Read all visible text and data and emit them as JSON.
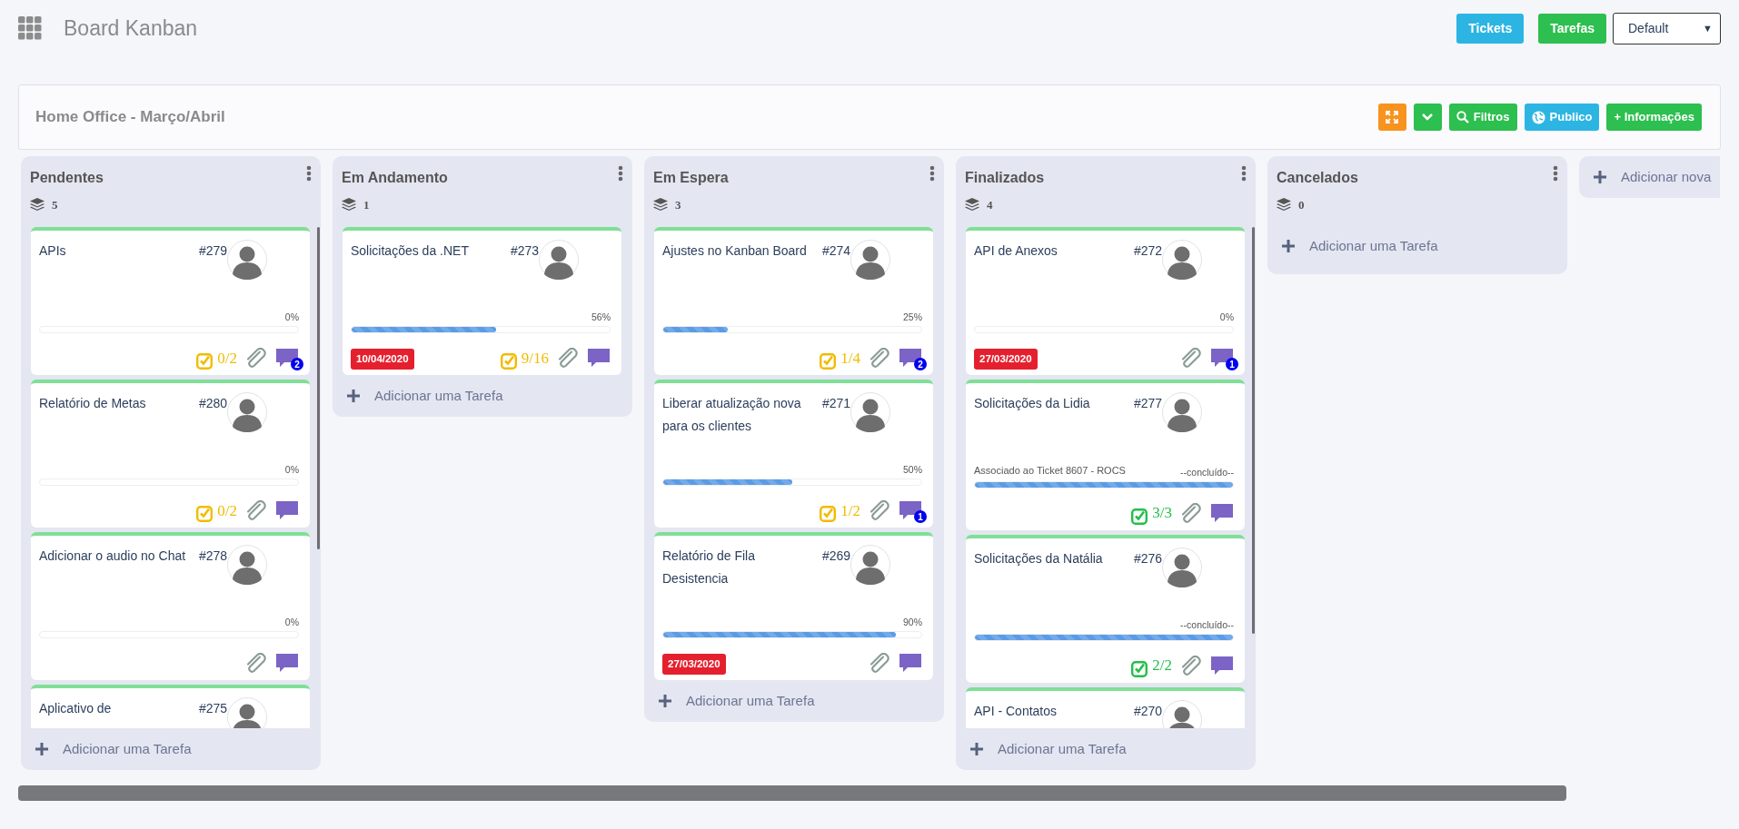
{
  "header": {
    "title": "Board Kanban",
    "buttons": [
      {
        "label": "Tickets",
        "color": "#2cb5e3"
      },
      {
        "label": "Tarefas",
        "color": "#2dbf4f"
      }
    ],
    "select": {
      "value": "Default",
      "arrow": "▼"
    }
  },
  "board": {
    "title": "Home Office - Março/Abril",
    "actions": [
      {
        "kind": "expand",
        "color": "#f7931e"
      },
      {
        "kind": "collapse",
        "color": "#2dbf4f"
      },
      {
        "kind": "search",
        "label": "Filtros",
        "color": "#2dbf4f"
      },
      {
        "kind": "globe",
        "label": "Publico",
        "color": "#2cb5e3"
      },
      {
        "kind": "text",
        "label": "+ Informações",
        "color": "#2dbf4f"
      }
    ]
  },
  "columns": [
    {
      "title": "Pendentes",
      "count": "5",
      "add_label": "Adicionar uma Tarefa",
      "cards": [
        {
          "title": "APIs",
          "number": "#279",
          "progress_label": "0%",
          "level": 0,
          "checklist": {
            "text": "0/2",
            "done": false
          },
          "comments": "2"
        },
        {
          "title": "Relatório de Metas",
          "number": "#280",
          "progress_label": "0%",
          "level": 0,
          "checklist": {
            "text": "0/2",
            "done": false
          }
        },
        {
          "title": "Adicionar o audio no Chat",
          "number": "#278",
          "progress_label": "0%",
          "level": 0
        },
        {
          "title": "Aplicativo de",
          "number": "#275",
          "partial": true
        }
      ]
    },
    {
      "title": "Em Andamento",
      "count": "1",
      "add_label": "Adicionar uma Tarefa",
      "cards": [
        {
          "title": "Solicitações da .NET",
          "number": "#273",
          "progress_label": "56%",
          "level": 0.56,
          "date": "10/04/2020",
          "checklist": {
            "text": "9/16",
            "done": false
          }
        }
      ]
    },
    {
      "title": "Em Espera",
      "count": "3",
      "add_label": "Adicionar uma Tarefa",
      "cards": [
        {
          "title": "Ajustes no Kanban Board",
          "number": "#274",
          "progress_label": "25%",
          "level": 0.25,
          "checklist": {
            "text": "1/4",
            "done": false
          },
          "comments": "2"
        },
        {
          "title": "Liberar atualização nova para os clientes",
          "number": "#271",
          "progress_label": "50%",
          "level": 0.5,
          "checklist": {
            "text": "1/2",
            "done": false
          },
          "comments": "1"
        },
        {
          "title": "Relatório de Fila Desistencia",
          "number": "#269",
          "progress_label": "90%",
          "level": 0.9,
          "date": "27/03/2020"
        }
      ]
    },
    {
      "title": "Finalizados",
      "count": "4",
      "add_label": "Adicionar uma Tarefa",
      "cards": [
        {
          "title": "API de Anexos",
          "number": "#272",
          "progress_label": "0%",
          "level": 0,
          "date": "27/03/2020",
          "comments": "1"
        },
        {
          "title": "Solicitações da Lidia",
          "number": "#277",
          "subtitle": "Associado ao Ticket 8607 - ROCS",
          "progress_label": "--concluído--",
          "level": 1,
          "checklist": {
            "text": "3/3",
            "done": true
          }
        },
        {
          "title": "Solicitações da Natália",
          "number": "#276",
          "progress_label": "--concluído--",
          "level": 1,
          "checklist": {
            "text": "2/2",
            "done": true
          }
        },
        {
          "title": "API - Contatos",
          "number": "#270",
          "partial": true
        }
      ]
    },
    {
      "title": "Cancelados",
      "count": "0",
      "add_label": "Adicionar uma Tarefa"
    }
  ],
  "add_column": {
    "label": "Adicionar nova"
  }
}
